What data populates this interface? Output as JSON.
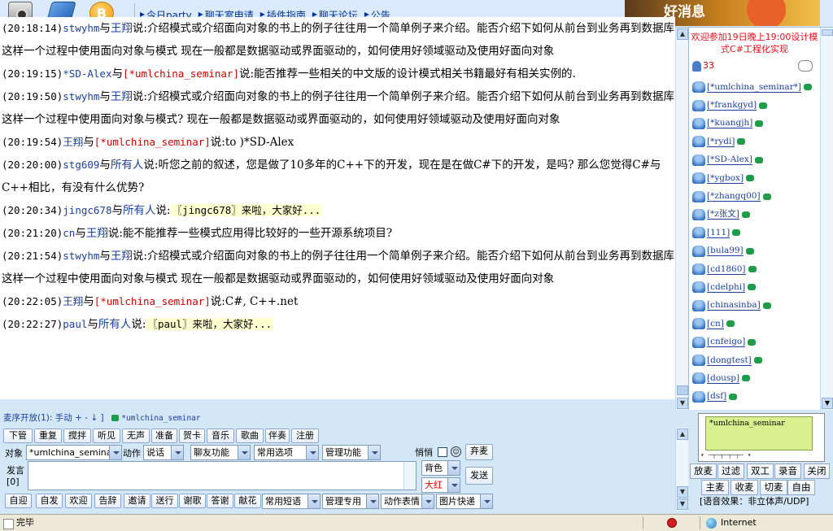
{
  "toolbar": {
    "icons": [
      "camera-icon",
      "notebook-icon",
      "blog-b-icon"
    ],
    "nav": [
      "今日party",
      "聊天室申请",
      "插件指南",
      "聊天论坛",
      "公告"
    ],
    "banner_text": "好消息"
  },
  "chat": {
    "lines": [
      {
        "time": "(20:18:14)",
        "from": "stwyhm",
        "to": "王翔",
        "said": "说:介绍模式或介绍面向对象的书上的例子往往用一个简单例子来介绍。能否介绍下如何从前台到业务再到数据库这样一个过程中使用面向对象与模式 现在一般都是数据驱动或界面驱动的，如何使用好领域驱动及使用好面向对象"
      },
      {
        "time": "(20:19:15)",
        "from": "*SD-Alex",
        "to": "[*umlchina_seminar]",
        "said": "说:能否推荐一些相关的中文版的设计模式相关书籍最好有相关实例的."
      },
      {
        "time": "(20:19:50)",
        "from": "stwyhm",
        "to": "王翔",
        "said": "说:介绍模式或介绍面向对象的书上的例子往往用一个简单例子来介绍。能否介绍下如何从前台到业务再到数据库这样一个过程中使用面向对象与模式? 现在一般都是数据驱动或界面驱动的，如何使用好领域驱动及使用好面向对象"
      },
      {
        "time": "(20:19:54)",
        "from": "王翔",
        "to": "[*umlchina_seminar]",
        "said": "说:to )*SD-Alex"
      },
      {
        "time": "(20:20:00)",
        "from": "stg609",
        "to": "所有人",
        "said": "说:听您之前的叙述，您是做了10多年的C++下的开发，现在是在做C#下的开发，是吗? 那么您觉得C#与C++相比，有没有什么优势?"
      },
      {
        "time": "(20:20:34)",
        "from": "jingc678",
        "to": "所有人",
        "said": "说:",
        "hl": "〖jingc678〗来啦，大家好..."
      },
      {
        "time": "(20:21:20)",
        "from": "cn",
        "to": "王翔",
        "said": "说:能不能推荐一些模式应用得比较好的一些开源系统项目?"
      },
      {
        "time": "(20:21:54)",
        "from": "stwyhm",
        "to": "王翔",
        "said": "说:介绍模式或介绍面向对象的书上的例子往往用一个简单例子来介绍。能否介绍下如何从前台到业务再到数据库这样一个过程中使用面向对象与模式 现在一般都是数据驱动或界面驱动的，如何使用好领域驱动及使用好面向对象"
      },
      {
        "time": "(20:22:05)",
        "from": "王翔",
        "to": "[*umlchina_seminar]",
        "said": "说:C#, C++.net"
      },
      {
        "time": "(20:22:27)",
        "from": "paul",
        "to": "所有人",
        "said": "说:",
        "hl": "〖paul〗来啦，大家好..."
      }
    ],
    "conj": "与"
  },
  "right_panel": {
    "announcement": "欢迎参加19日晚上19:00设计模式C#工程化实现",
    "count": "33",
    "users": [
      "[*umlchina_seminar*]",
      "[*frankgyd]",
      "[*kuangjh]",
      "[*rydi]",
      "[*SD-Alex]",
      "[*ygbox]",
      "[*zhangq00]",
      "[*z张文]",
      "[111]",
      "[bula99]",
      "[cd1860]",
      "[cdelphi]",
      "[chinasinba]",
      "[cn]",
      "[cnfeigo]",
      "[dongtest]",
      "[dousp]",
      "[dsf]"
    ]
  },
  "status": {
    "mode": "麦序开放(1): 手动 + - ↓ ]",
    "user": "*umlchina_seminar"
  },
  "controls": {
    "row1": [
      "下管",
      "重复",
      "搅拌",
      "听见",
      "无声",
      "准备",
      "贺卡",
      "音乐",
      "歌曲",
      "伴奏",
      "注册"
    ],
    "target_label": "对象",
    "target_value": "*umlchina_semina",
    "action_label": "动作",
    "action_value": "说话",
    "friend_func": "聊友功能",
    "common_opts": "常用选项",
    "admin_func": "管理功能",
    "quiet_label": "悄悄",
    "discard": "弃麦",
    "speak_label": "发言",
    "speak_count": "[0]",
    "bg_label": "背色",
    "color_value": "大红",
    "send": "发送",
    "row3_btns": [
      "自迎",
      "自发",
      "欢迎",
      "告辞",
      "邀请",
      "送行",
      "谢歌",
      "答谢",
      "献花"
    ],
    "common_phrases": "常用短语",
    "admin_only": "管理专用",
    "action_emotes": "动作表情",
    "picture_quick": "图片快递"
  },
  "right_controls": {
    "preview_name": "*umlchina_seminar",
    "row1": [
      "放麦",
      "过滤",
      "双工",
      "录音",
      "关闭"
    ],
    "row2": [
      "主麦",
      "收麦",
      "切麦",
      "自由"
    ],
    "voice": "[语音效果：非立体声/UDP]"
  },
  "bottom": {
    "done": "完毕",
    "zone": "Internet"
  }
}
